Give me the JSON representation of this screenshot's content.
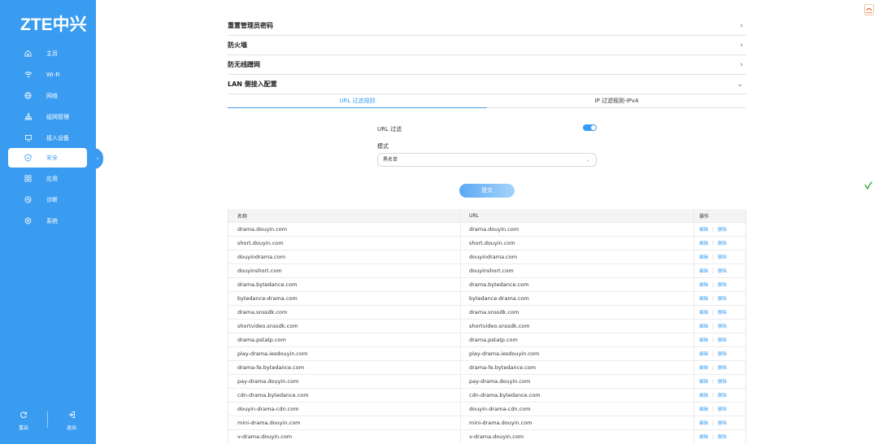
{
  "sidebar": {
    "logo": "ZTE中兴",
    "items": [
      {
        "label": "主页",
        "icon": "home-icon"
      },
      {
        "label": "Wi-Fi",
        "icon": "wifi-icon"
      },
      {
        "label": "网络",
        "icon": "globe-icon"
      },
      {
        "label": "组网管理",
        "icon": "topology-icon"
      },
      {
        "label": "接入设备",
        "icon": "monitor-icon"
      },
      {
        "label": "安全",
        "icon": "shield-icon",
        "active": true
      },
      {
        "label": "应用",
        "icon": "apps-icon"
      },
      {
        "label": "诊断",
        "icon": "diagnose-icon"
      },
      {
        "label": "系统",
        "icon": "settings-icon"
      }
    ],
    "bottom": [
      {
        "label": "重启",
        "icon": "restart-icon"
      },
      {
        "label": "退出",
        "icon": "logout-icon"
      }
    ]
  },
  "sections": [
    {
      "title": "重置管理员密码",
      "state": "collapsed"
    },
    {
      "title": "防火墙",
      "state": "collapsed"
    },
    {
      "title": "防无线蹭网",
      "state": "collapsed"
    },
    {
      "title": "LAN 侧接入配置",
      "state": "expanded"
    }
  ],
  "subtabs": [
    {
      "label": "URL 过滤规则",
      "active": true
    },
    {
      "label": "IP 过滤规则-IPv4",
      "active": false
    }
  ],
  "form": {
    "url_filter_label": "URL 过滤",
    "url_filter_enabled": true,
    "mode_label": "模式",
    "mode_value": "黑名单",
    "submit_label": "提交"
  },
  "table": {
    "headers": {
      "name": "名称",
      "url": "URL",
      "ops": "操作"
    },
    "edit_label": "编辑",
    "delete_label": "删除",
    "rows": [
      {
        "name": "drama.douyin.com",
        "url": "drama.douyin.com"
      },
      {
        "name": "short.douyin.com",
        "url": "short.douyin.com"
      },
      {
        "name": "douyindrama.com",
        "url": "douyindrama.com"
      },
      {
        "name": "douyinshort.com",
        "url": "douyinshort.com"
      },
      {
        "name": "drama.bytedance.com",
        "url": "drama.bytedance.com"
      },
      {
        "name": "bytedance-drama.com",
        "url": "bytedance-drama.com"
      },
      {
        "name": "drama.snssdk.com",
        "url": "drama.snssdk.com"
      },
      {
        "name": "shortvideo.snssdk.com",
        "url": "shortvideo.snssdk.com"
      },
      {
        "name": "drama.pstatp.com",
        "url": "drama.pstatp.com"
      },
      {
        "name": "play-drama.iesdouyin.com",
        "url": "play-drama.iesdouyin.com"
      },
      {
        "name": "drama-fe.bytedance.com",
        "url": "drama-fe.bytedance.com"
      },
      {
        "name": "pay-drama.douyin.com",
        "url": "pay-drama.douyin.com"
      },
      {
        "name": "cdn-drama.bytedance.com",
        "url": "cdn-drama.bytedance.com"
      },
      {
        "name": "douyin-drama-cdn.com",
        "url": "douyin-drama-cdn.com"
      },
      {
        "name": "mini-drama.douyin.com",
        "url": "mini-drama.douyin.com"
      },
      {
        "name": "v-drama.douyin.com",
        "url": "v-drama.douyin.com"
      }
    ]
  },
  "colors": {
    "accent": "#3a9cf0",
    "sidebar": "#3a9cf0"
  }
}
